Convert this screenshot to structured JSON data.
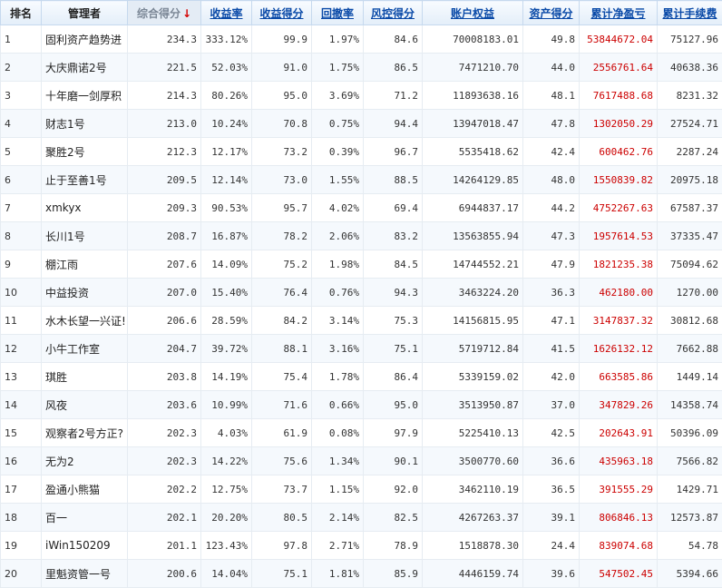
{
  "headers": {
    "rank": "排名",
    "manager": "管理者",
    "composite_score": "综合得分",
    "sort_arrow": "↓",
    "return_rate": "收益率",
    "return_score": "收益得分",
    "drawdown": "回撤率",
    "risk_score": "风控得分",
    "account_equity": "账户权益",
    "asset_score": "资产得分",
    "cumulative_pnl": "累计净盈亏",
    "cumulative_fee": "累计手续费"
  },
  "rows": [
    {
      "rank": "1",
      "manager": "固利资产趋势进",
      "score": "234.3",
      "ret": "333.12%",
      "retscore": "99.9",
      "dd": "1.97%",
      "risk": "84.6",
      "equity": "70008183.01",
      "asset": "49.8",
      "pnl": "53844672.04",
      "fee": "75127.96"
    },
    {
      "rank": "2",
      "manager": "大庆鼎诺2号",
      "score": "221.5",
      "ret": "52.03%",
      "retscore": "91.0",
      "dd": "1.75%",
      "risk": "86.5",
      "equity": "7471210.70",
      "asset": "44.0",
      "pnl": "2556761.64",
      "fee": "40638.36"
    },
    {
      "rank": "3",
      "manager": "十年磨一剑厚积",
      "score": "214.3",
      "ret": "80.26%",
      "retscore": "95.0",
      "dd": "3.69%",
      "risk": "71.2",
      "equity": "11893638.16",
      "asset": "48.1",
      "pnl": "7617488.68",
      "fee": "8231.32"
    },
    {
      "rank": "4",
      "manager": "财志1号",
      "score": "213.0",
      "ret": "10.24%",
      "retscore": "70.8",
      "dd": "0.75%",
      "risk": "94.4",
      "equity": "13947018.47",
      "asset": "47.8",
      "pnl": "1302050.29",
      "fee": "27524.71"
    },
    {
      "rank": "5",
      "manager": "聚胜2号",
      "score": "212.3",
      "ret": "12.17%",
      "retscore": "73.2",
      "dd": "0.39%",
      "risk": "96.7",
      "equity": "5535418.62",
      "asset": "42.4",
      "pnl": "600462.76",
      "fee": "2287.24"
    },
    {
      "rank": "6",
      "manager": "止于至善1号",
      "score": "209.5",
      "ret": "12.14%",
      "retscore": "73.0",
      "dd": "1.55%",
      "risk": "88.5",
      "equity": "14264129.85",
      "asset": "48.0",
      "pnl": "1550839.82",
      "fee": "20975.18"
    },
    {
      "rank": "7",
      "manager": "xmkyx",
      "score": "209.3",
      "ret": "90.53%",
      "retscore": "95.7",
      "dd": "4.02%",
      "risk": "69.4",
      "equity": "6944837.17",
      "asset": "44.2",
      "pnl": "4752267.63",
      "fee": "67587.37"
    },
    {
      "rank": "8",
      "manager": "长川1号",
      "score": "208.7",
      "ret": "16.87%",
      "retscore": "78.2",
      "dd": "2.06%",
      "risk": "83.2",
      "equity": "13563855.94",
      "asset": "47.3",
      "pnl": "1957614.53",
      "fee": "37335.47"
    },
    {
      "rank": "9",
      "manager": "棚江雨",
      "score": "207.6",
      "ret": "14.09%",
      "retscore": "75.2",
      "dd": "1.98%",
      "risk": "84.5",
      "equity": "14744552.21",
      "asset": "47.9",
      "pnl": "1821235.38",
      "fee": "75094.62"
    },
    {
      "rank": "10",
      "manager": "中益投资",
      "score": "207.0",
      "ret": "15.40%",
      "retscore": "76.4",
      "dd": "0.76%",
      "risk": "94.3",
      "equity": "3463224.20",
      "asset": "36.3",
      "pnl": "462180.00",
      "fee": "1270.00"
    },
    {
      "rank": "11",
      "manager": "水木长望一兴证!",
      "score": "206.6",
      "ret": "28.59%",
      "retscore": "84.2",
      "dd": "3.14%",
      "risk": "75.3",
      "equity": "14156815.95",
      "asset": "47.1",
      "pnl": "3147837.32",
      "fee": "30812.68"
    },
    {
      "rank": "12",
      "manager": "小牛工作室",
      "score": "204.7",
      "ret": "39.72%",
      "retscore": "88.1",
      "dd": "3.16%",
      "risk": "75.1",
      "equity": "5719712.84",
      "asset": "41.5",
      "pnl": "1626132.12",
      "fee": "7662.88"
    },
    {
      "rank": "13",
      "manager": "琪胜",
      "score": "203.8",
      "ret": "14.19%",
      "retscore": "75.4",
      "dd": "1.78%",
      "risk": "86.4",
      "equity": "5339159.02",
      "asset": "42.0",
      "pnl": "663585.86",
      "fee": "1449.14"
    },
    {
      "rank": "14",
      "manager": "风夜",
      "score": "203.6",
      "ret": "10.99%",
      "retscore": "71.6",
      "dd": "0.66%",
      "risk": "95.0",
      "equity": "3513950.87",
      "asset": "37.0",
      "pnl": "347829.26",
      "fee": "14358.74"
    },
    {
      "rank": "15",
      "manager": "观察者2号方正?",
      "score": "202.3",
      "ret": "4.03%",
      "retscore": "61.9",
      "dd": "0.08%",
      "risk": "97.9",
      "equity": "5225410.13",
      "asset": "42.5",
      "pnl": "202643.91",
      "fee": "50396.09"
    },
    {
      "rank": "16",
      "manager": "无为2",
      "score": "202.3",
      "ret": "14.22%",
      "retscore": "75.6",
      "dd": "1.34%",
      "risk": "90.1",
      "equity": "3500770.60",
      "asset": "36.6",
      "pnl": "435963.18",
      "fee": "7566.82"
    },
    {
      "rank": "17",
      "manager": "盈通小熊猫",
      "score": "202.2",
      "ret": "12.75%",
      "retscore": "73.7",
      "dd": "1.15%",
      "risk": "92.0",
      "equity": "3462110.19",
      "asset": "36.5",
      "pnl": "391555.29",
      "fee": "1429.71"
    },
    {
      "rank": "18",
      "manager": "百一",
      "score": "202.1",
      "ret": "20.20%",
      "retscore": "80.5",
      "dd": "2.14%",
      "risk": "82.5",
      "equity": "4267263.37",
      "asset": "39.1",
      "pnl": "806846.13",
      "fee": "12573.87"
    },
    {
      "rank": "19",
      "manager": "iWin150209",
      "score": "201.1",
      "ret": "123.43%",
      "retscore": "97.8",
      "dd": "2.71%",
      "risk": "78.9",
      "equity": "1518878.30",
      "asset": "24.4",
      "pnl": "839074.68",
      "fee": "54.78"
    },
    {
      "rank": "20",
      "manager": "里魁资管一号",
      "score": "200.6",
      "ret": "14.04%",
      "retscore": "75.1",
      "dd": "1.81%",
      "risk": "85.9",
      "equity": "4446159.74",
      "asset": "39.6",
      "pnl": "547502.45",
      "fee": "5394.66"
    }
  ],
  "colors": {
    "link": "#0a4aa8",
    "profit": "#cc0000",
    "sort_arrow": "#d40000"
  }
}
